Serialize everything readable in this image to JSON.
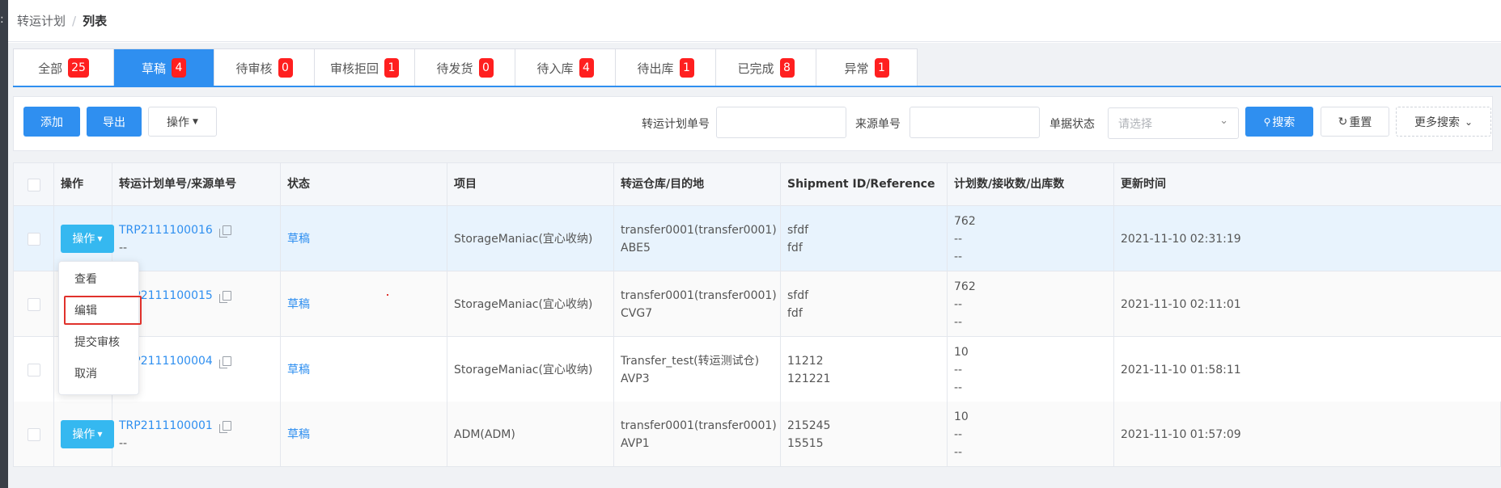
{
  "breadcrumb": {
    "parent": "转运计划",
    "separator": "/",
    "current": "列表"
  },
  "tabs": [
    {
      "label": "全部",
      "count": "25",
      "active": false
    },
    {
      "label": "草稿",
      "count": "4",
      "active": true
    },
    {
      "label": "待审核",
      "count": "0",
      "active": false
    },
    {
      "label": "审核拒回",
      "count": "1",
      "active": false
    },
    {
      "label": "待发货",
      "count": "0",
      "active": false
    },
    {
      "label": "待入库",
      "count": "4",
      "active": false
    },
    {
      "label": "待出库",
      "count": "1",
      "active": false
    },
    {
      "label": "已完成",
      "count": "8",
      "active": false
    },
    {
      "label": "异常",
      "count": "1",
      "active": false
    }
  ],
  "toolbar": {
    "add_label": "添加",
    "export_label": "导出",
    "operation_label": "操作",
    "plan_no_label": "转运计划单号",
    "plan_no_value": "",
    "source_no_label": "来源单号",
    "source_no_value": "",
    "status_label": "单据状态",
    "status_placeholder": "请选择",
    "search_label": "搜索",
    "reset_label": "重置",
    "more_search_label": "更多搜索"
  },
  "table": {
    "columns": [
      "操作",
      "转运计划单号/来源单号",
      "状态",
      "项目",
      "转运仓库/目的地",
      "Shipment ID/Reference ID",
      "计划数/接收数/出库数",
      "更新时间"
    ],
    "rows": [
      {
        "op": "操作",
        "plan_no": "TRP2111100016",
        "source_no": "--",
        "status": "草稿",
        "project": "StorageManiac(宜心收纳)",
        "warehouse": "transfer0001(transfer0001)",
        "destination": "ABE5",
        "shipment_id": "sfdf",
        "reference_id": "fdf",
        "planned": "762",
        "received": "--",
        "outbound": "--",
        "updated": "2021-11-10 02:31:19"
      },
      {
        "op": "操作",
        "plan_no": "TRP2111100015",
        "source_no": "--",
        "status": "草稿",
        "project": "StorageManiac(宜心收纳)",
        "warehouse": "transfer0001(transfer0001)",
        "destination": "CVG7",
        "shipment_id": "sfdf",
        "reference_id": "fdf",
        "planned": "762",
        "received": "--",
        "outbound": "--",
        "updated": "2021-11-10 02:11:01"
      },
      {
        "op": "操作",
        "plan_no": "TRP2111100004",
        "source_no": "--",
        "status": "草稿",
        "project": "StorageManiac(宜心收纳)",
        "warehouse": "Transfer_test(转运测试仓)",
        "destination": "AVP3",
        "shipment_id": "11212",
        "reference_id": "121221",
        "planned": "10",
        "received": "--",
        "outbound": "--",
        "updated": "2021-11-10 01:58:11"
      },
      {
        "op": "操作",
        "plan_no": "TRP2111100001",
        "source_no": "--",
        "status": "草稿",
        "project": "ADM(ADM)",
        "warehouse": "transfer0001(transfer0001)",
        "destination": "AVP1",
        "shipment_id": "215245",
        "reference_id": "15515",
        "planned": "10",
        "received": "--",
        "outbound": "--",
        "updated": "2021-11-10 01:57:09"
      }
    ]
  },
  "dropdown": {
    "items": [
      "查看",
      "编辑",
      "提交审核",
      "取消"
    ],
    "highlighted": "编辑"
  },
  "colors": {
    "primary": "#2f8ff0",
    "badge": "#ff1f1f",
    "op_button": "#35b8f0",
    "highlight_border": "#e0322c"
  }
}
